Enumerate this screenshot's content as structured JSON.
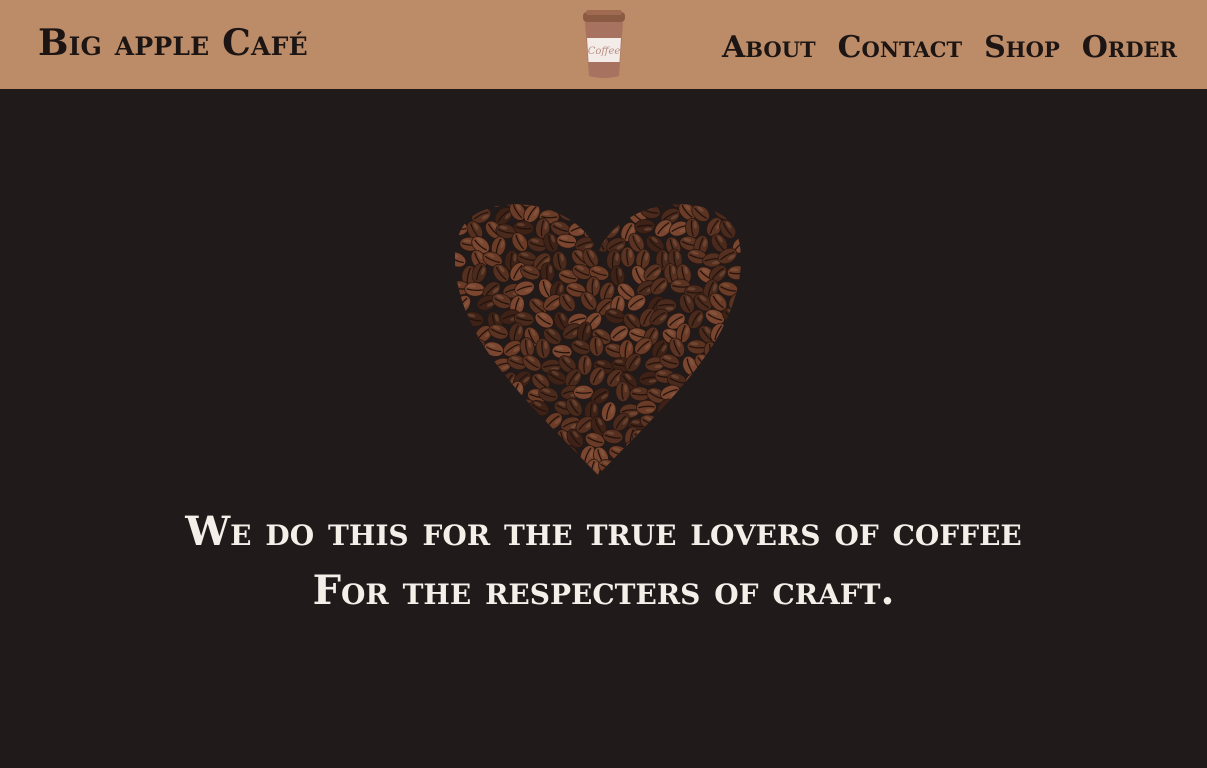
{
  "header": {
    "brand": "Big apple Café",
    "logo_icon": "coffee-cup-icon",
    "logo_text": "Coffee",
    "nav": [
      {
        "label": "About"
      },
      {
        "label": "Contact"
      },
      {
        "label": "Shop"
      },
      {
        "label": "Order"
      }
    ],
    "background_color": "#bc8c69"
  },
  "hero": {
    "image_icon": "coffee-bean-heart-icon",
    "tagline_line1": "We do this for the true lovers of coffee",
    "tagline_line2": "For the respecters of craft.",
    "background_color": "#211a1b",
    "text_color": "#f4efe9"
  }
}
